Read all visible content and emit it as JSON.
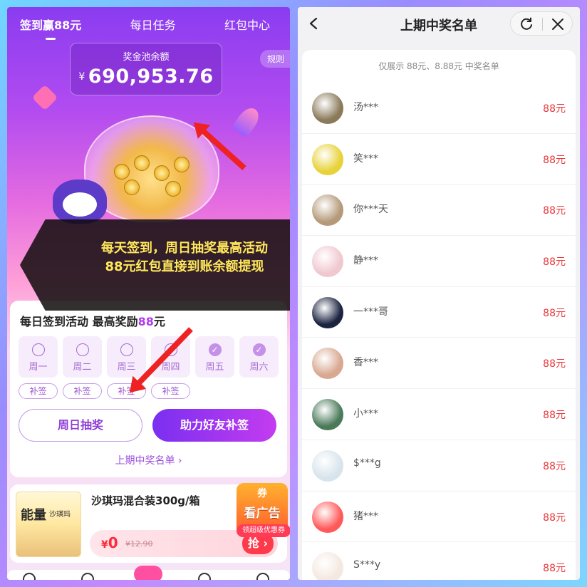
{
  "left": {
    "tabs": [
      {
        "label": "签到赢88元",
        "active": true
      },
      {
        "label": "每日任务",
        "active": false
      },
      {
        "label": "红包中心",
        "active": false
      }
    ],
    "rules_label": "规则",
    "pool": {
      "label": "奖金池余额",
      "currency": "¥",
      "amount": "690,953.76"
    },
    "overlay": {
      "line1": "每天签到，周日抽奖最高活动",
      "line2": "88元红包直接到账余额提现"
    },
    "checkin": {
      "title_prefix": "每日签到活动  最高奖励",
      "title_highlight": "88",
      "title_suffix": "元",
      "days": [
        {
          "label": "周一",
          "checked": false
        },
        {
          "label": "周二",
          "checked": false
        },
        {
          "label": "周三",
          "checked": false
        },
        {
          "label": "周四",
          "checked": false
        },
        {
          "label": "周五",
          "checked": true
        },
        {
          "label": "周六",
          "checked": true
        }
      ],
      "makeup_label": "补签",
      "sunday_draw_label": "周日抽奖",
      "help_friend_label": "助力好友补签",
      "prev_winners_link": "上期中奖名单 ›"
    },
    "product": {
      "name": "沙琪玛混合装300g/箱",
      "price_currency": "¥",
      "price": "0",
      "old_price": "¥12.90",
      "grab_label": "抢 ›",
      "img_title": "能量",
      "img_subtitle": "沙琪玛"
    },
    "ad_badge": {
      "coupon": "券",
      "ad": "看广告",
      "sub": "领超级优惠券"
    }
  },
  "right": {
    "title": "上期中奖名单",
    "note": "仅展示 88元、8.88元 中奖名单",
    "winners": [
      {
        "name": "汤***",
        "amount": "88元",
        "avatar_color": "#8a7a5a"
      },
      {
        "name": "笑***",
        "amount": "88元",
        "avatar_color": "#e8d23a"
      },
      {
        "name": "你***天",
        "amount": "88元",
        "avatar_color": "#b59a7a"
      },
      {
        "name": "静***",
        "amount": "88元",
        "avatar_color": "#f0c8d0"
      },
      {
        "name": "一***哥",
        "amount": "88元",
        "avatar_color": "#1b2340"
      },
      {
        "name": "香***",
        "amount": "88元",
        "avatar_color": "#d8a890"
      },
      {
        "name": "小***",
        "amount": "88元",
        "avatar_color": "#4a7a5a"
      },
      {
        "name": "$***g",
        "amount": "88元",
        "avatar_color": "#d8e4ec"
      },
      {
        "name": "猪***",
        "amount": "88元",
        "avatar_color": "#ff5a5a"
      },
      {
        "name": "S***y",
        "amount": "88元",
        "avatar_color": "#f4e8e0"
      }
    ]
  },
  "colors": {
    "accent": "#8f3fd6",
    "prize_red": "#e8383d",
    "overlay_text": "#ffe85a"
  }
}
